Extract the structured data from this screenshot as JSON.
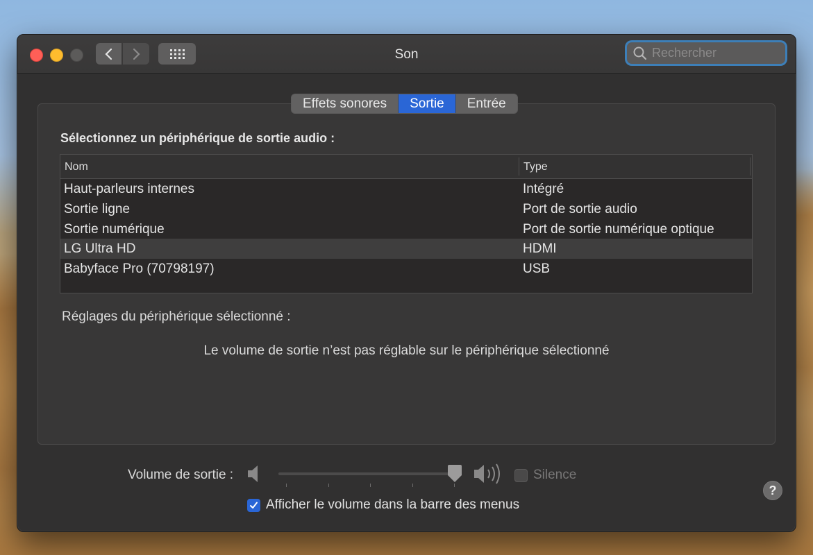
{
  "window": {
    "title": "Son",
    "search_placeholder": "Rechercher"
  },
  "tabs": [
    {
      "label": "Effets sonores",
      "active": false
    },
    {
      "label": "Sortie",
      "active": true
    },
    {
      "label": "Entrée",
      "active": false
    }
  ],
  "output": {
    "section_title": "Sélectionnez un périphérique de sortie audio :",
    "columns": [
      "Nom",
      "Type"
    ],
    "rows": [
      {
        "name": "Haut-parleurs internes",
        "type": "Intégré",
        "selected": false
      },
      {
        "name": "Sortie ligne",
        "type": "Port de sortie audio",
        "selected": false
      },
      {
        "name": "Sortie numérique",
        "type": "Port de sortie numérique optique",
        "selected": false
      },
      {
        "name": "LG Ultra HD",
        "type": "HDMI",
        "selected": true
      },
      {
        "name": "Babyface Pro (70798197)",
        "type": "USB",
        "selected": false
      }
    ],
    "settings_label": "Réglages du périphérique sélectionné :",
    "info_text": "Le volume de sortie n’est pas réglable sur le périphérique sélectionné",
    "help_label": "?"
  },
  "volume": {
    "label": "Volume de sortie :",
    "level_fraction": 1.0,
    "mute_label": "Silence",
    "mute_checked": false,
    "show_in_menubar_label": "Afficher le volume dans la barre des menus",
    "show_in_menubar_checked": true
  },
  "colors": {
    "accent": "#2a66d6",
    "window_bg": "#313030"
  }
}
